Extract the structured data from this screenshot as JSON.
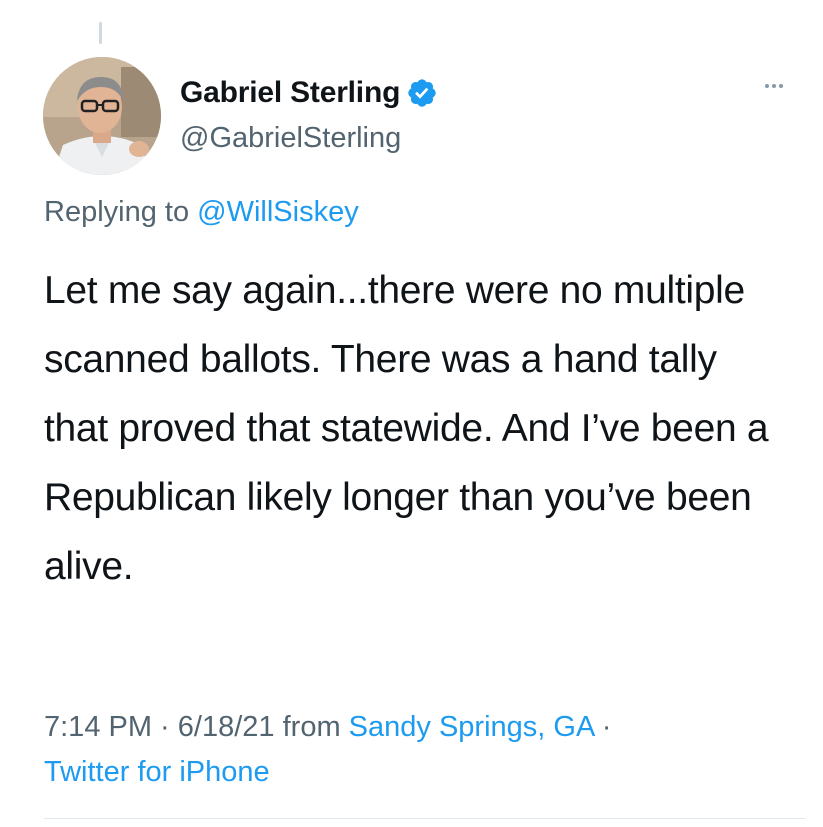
{
  "tweet": {
    "author": {
      "display_name": "Gabriel Sterling",
      "handle": "@GabrielSterling",
      "verified": true,
      "avatar_icon": "avatar-photo"
    },
    "reply_prefix": "Replying to ",
    "reply_to": "@WillSiskey",
    "text": "Let me say again...there were no multiple scanned ballots. There was a hand tally that proved that statewide. And I’ve been a Republican likely longer than you’ve been alive.",
    "time": "7:14 PM",
    "separator": " · ",
    "date": "6/18/21",
    "from_label": " from ",
    "location": "Sandy Springs, GA",
    "client": "Twitter for iPhone",
    "more_icon": "more-dots-icon"
  },
  "colors": {
    "link": "#1d9bf0",
    "secondary_text": "#536471",
    "primary_text": "#0f1419",
    "verified_badge": "#1d9bf0"
  }
}
